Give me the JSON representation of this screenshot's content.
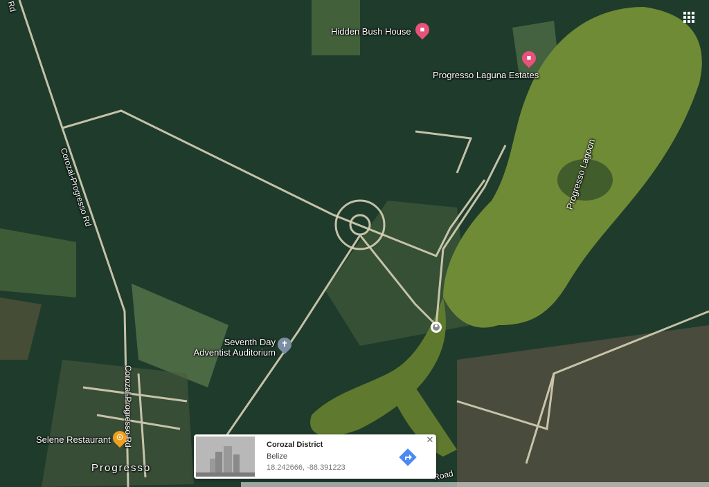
{
  "map": {
    "colors": {
      "forest": "#1e3a29",
      "lagoon": "#6f8a34",
      "road": "#d8d2b8",
      "field": "#5a7a4a"
    },
    "places": [
      {
        "id": "hidden-bush-house",
        "label": "Hidden Bush House",
        "icon": "hotel-icon",
        "color": "#e8517a"
      },
      {
        "id": "progresso-laguna-estates",
        "label": "Progresso Laguna Estates",
        "icon": "hotel-icon",
        "color": "#e8517a"
      },
      {
        "id": "seventh-day-auditorium",
        "label": "Seventh Day\nAdventist Auditorium",
        "icon": "church-icon",
        "color": "#7d8ea3"
      },
      {
        "id": "selene-restaurant",
        "label": "Selene Restaurant",
        "icon": "restaurant-icon",
        "color": "#f0a020"
      }
    ],
    "road_labels": {
      "corozal_upper": "Corozal-Progresso Rd",
      "corozal_lower": "Corozal-Progresso Rd",
      "top_fragment": "Rd",
      "bottom_road": "Road"
    },
    "water_label": "Progresso Lagoon",
    "town_label": "Progresso"
  },
  "card": {
    "title": "Corozal District",
    "subtitle": "Belize",
    "coords": "18.242666, -88.391223",
    "close_icon": "close-icon",
    "directions_icon": "directions-icon"
  },
  "controls": {
    "apps_icon": "apps-grid-icon"
  }
}
